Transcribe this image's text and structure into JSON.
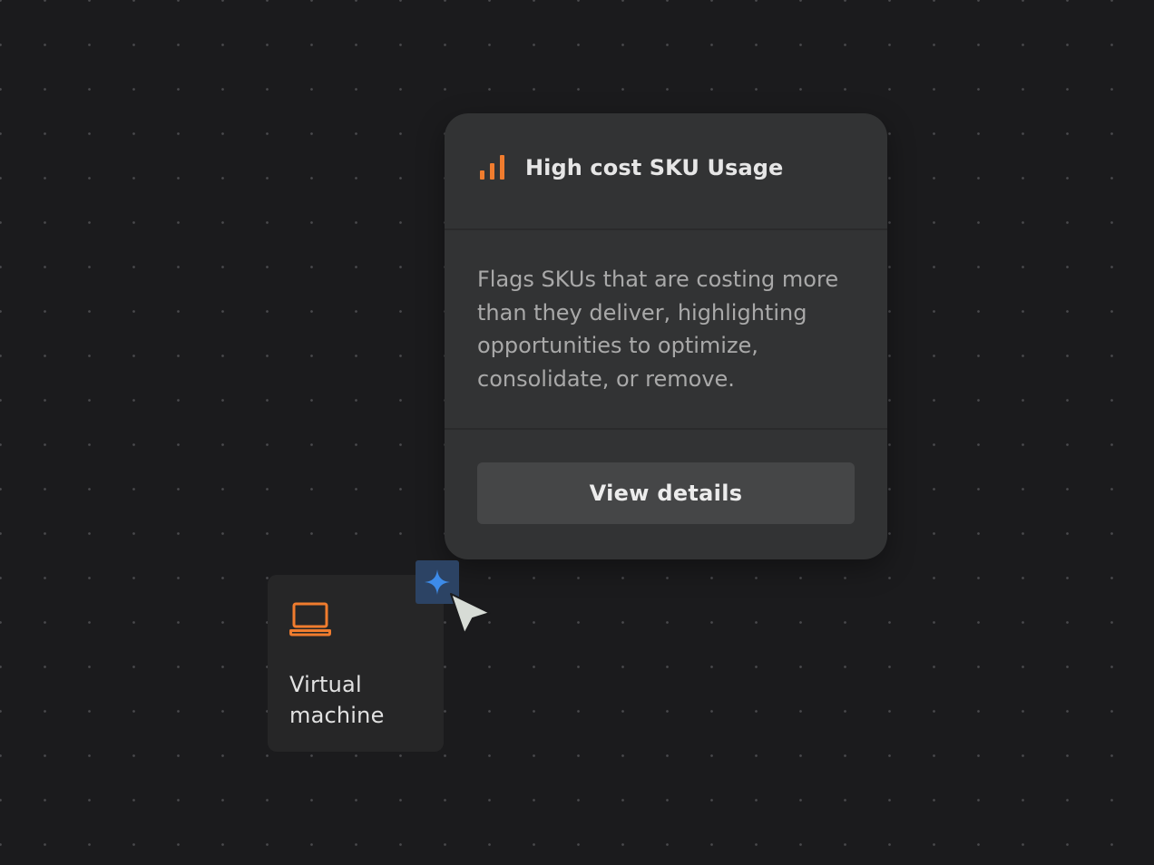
{
  "insight_card": {
    "icon": "bar-chart-icon",
    "title": "High cost SKU Usage",
    "description": "Flags SKUs that are costing more than they deliver, highlighting opportunities to optimize, consolidate, or remove.",
    "button_label": "View details"
  },
  "node": {
    "icon": "laptop-icon",
    "label_line1": "Virtual",
    "label_line2": "machine"
  },
  "badge": {
    "icon": "sparkle-icon"
  },
  "colors": {
    "accent_orange": "#f07c2e",
    "accent_blue": "#3d8be9",
    "background": "#1b1b1d",
    "card": "#323334"
  }
}
